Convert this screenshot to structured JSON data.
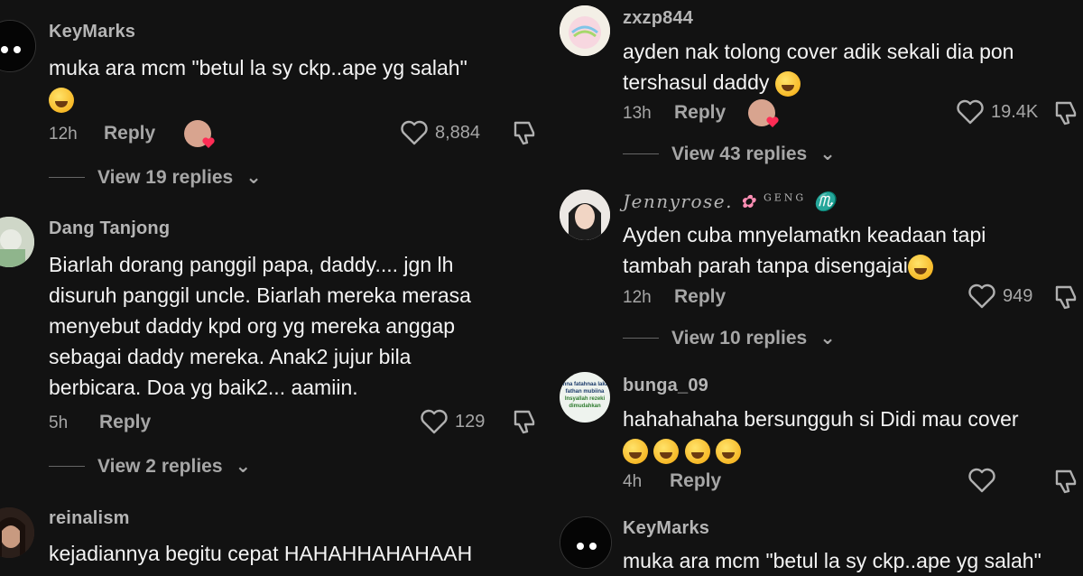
{
  "left": [
    {
      "username": "KeyMarks",
      "lines": [
        "muka ara mcm \"betul la sy ckp..ape yg salah\""
      ],
      "time": "12h",
      "reply": "Reply",
      "likes": "8,884",
      "view_replies": "View 19 replies"
    },
    {
      "username": "Dang Tanjong",
      "lines": [
        "Biarlah dorang panggil papa, daddy.... jgn lh",
        "disuruh panggil uncle. Biarlah mereka merasa",
        "menyebut daddy kpd org yg mereka anggap",
        "sebagai daddy mereka. Anak2 jujur bila",
        "berbicara. Doa yg baik2... aamiin."
      ],
      "time": "5h",
      "reply": "Reply",
      "likes": "129",
      "view_replies": "View 2 replies"
    },
    {
      "username": "reinalism",
      "lines": [
        "kejadiannya begitu cepat HAHAHHAHAHAAH"
      ]
    }
  ],
  "right": [
    {
      "username": "zxzp844",
      "lines": [
        "ayden nak tolong cover adik sekali dia pon",
        "tershasul daddy"
      ],
      "time": "13h",
      "reply": "Reply",
      "likes": "19.4K",
      "view_replies": "View 43 replies"
    },
    {
      "username": "Jennyrose.",
      "username_suffix": "GENG",
      "lines": [
        "Ayden cuba mnyelamatkn keadaan tapi",
        "tambah parah tanpa disengajai"
      ],
      "time": "12h",
      "reply": "Reply",
      "likes": "949",
      "view_replies": "View 10 replies"
    },
    {
      "username": "bunga_09",
      "avatar_text": [
        "Inna fatahnaa laka",
        "fathan mubiina",
        "Insyallah rezeki",
        "dimudahkan"
      ],
      "lines": [
        "hahahahaha bersungguh si Didi mau cover"
      ],
      "time": "4h",
      "reply": "Reply"
    },
    {
      "username": "KeyMarks",
      "lines": [
        "muka ara mcm \"betul la sy ckp..ape yg salah\""
      ]
    }
  ]
}
